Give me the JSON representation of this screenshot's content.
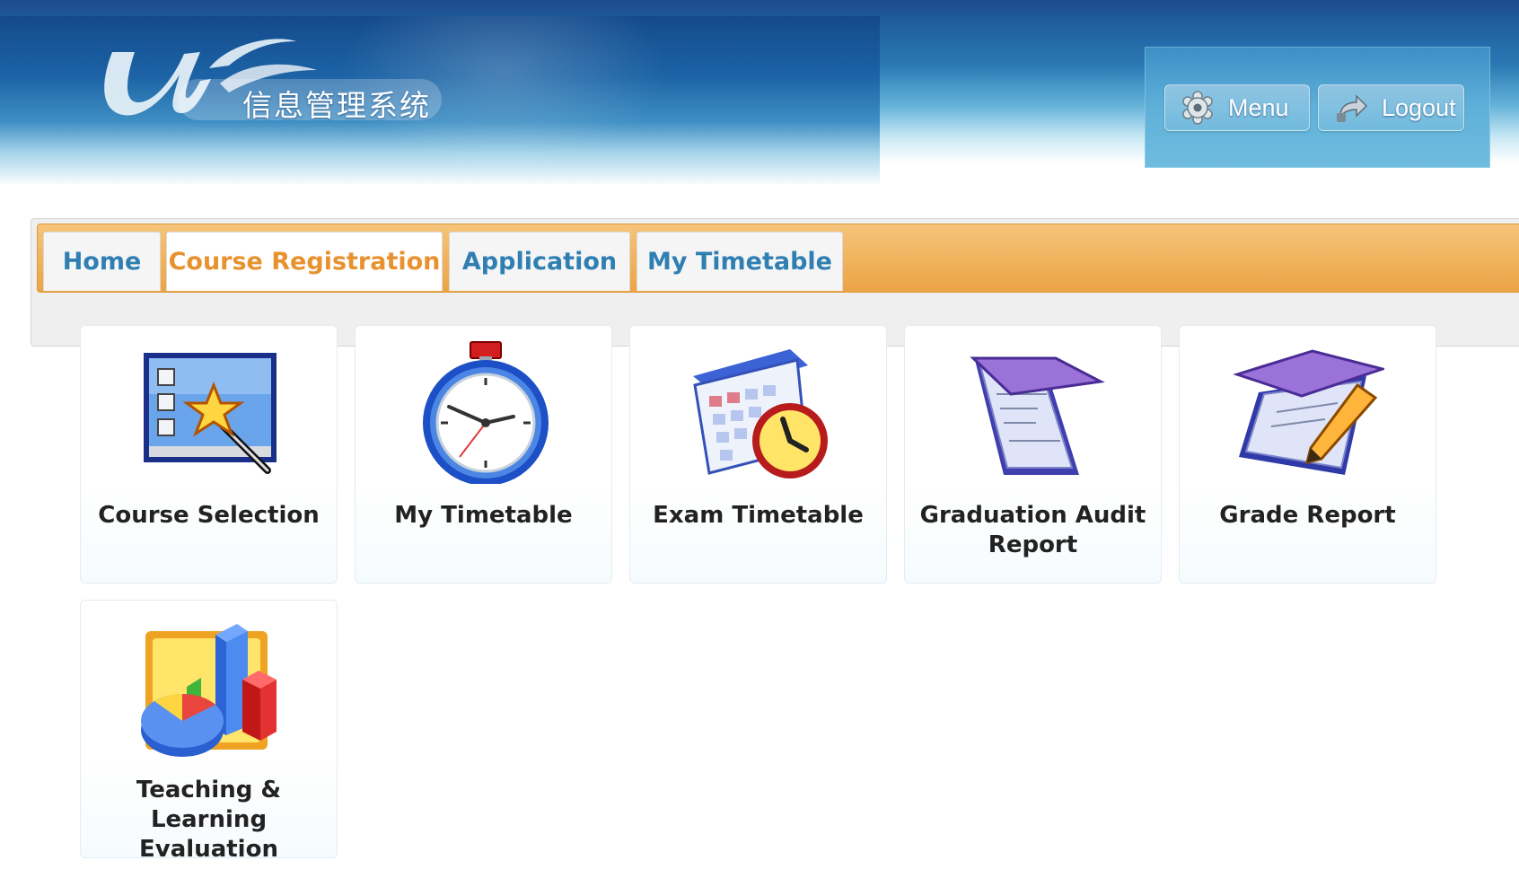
{
  "header": {
    "logo_caption": "信息管理系统",
    "nav": [
      {
        "label": "Menu",
        "icon": "gear-icon"
      },
      {
        "label": "Logout",
        "icon": "logout-arrow-icon"
      }
    ]
  },
  "tabs": [
    {
      "label": "Home",
      "active": false
    },
    {
      "label": "Course Registration",
      "active": true
    },
    {
      "label": "Application",
      "active": false
    },
    {
      "label": "My Timetable",
      "active": false
    }
  ],
  "tiles": [
    {
      "label": "Course Selection",
      "icon": "course-selection-icon"
    },
    {
      "label": "My Timetable",
      "icon": "stopwatch-icon"
    },
    {
      "label": "Exam Timetable",
      "icon": "calendar-clock-icon"
    },
    {
      "label": "Graduation Audit Report",
      "icon": "graduation-report-icon"
    },
    {
      "label": "Grade Report",
      "icon": "grade-report-icon"
    },
    {
      "label": "Teaching & Learning Evaluation",
      "icon": "evaluation-chart-icon"
    }
  ],
  "colors": {
    "header_blue": "#1c63a5",
    "tab_bar_orange": "#eba445",
    "tab_text": "#2f7fb3",
    "tab_active_text": "#e8922f",
    "tile_label": "#222222"
  }
}
